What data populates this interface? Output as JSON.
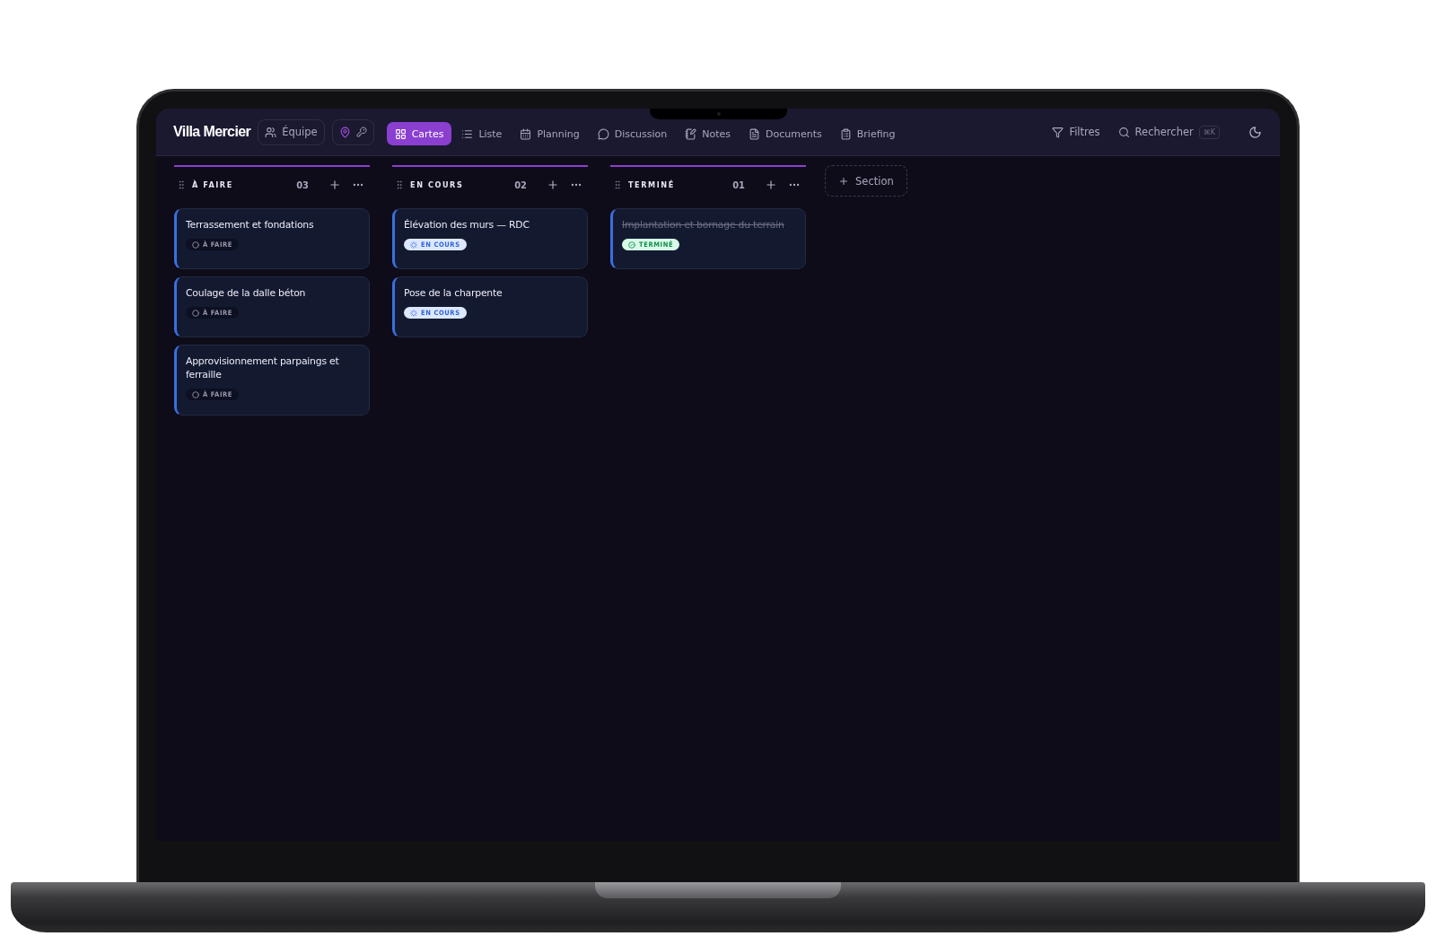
{
  "app": {
    "title": "Villa Mercier",
    "team_button": {
      "label": "Équipe"
    },
    "nav": [
      {
        "label": "Cartes",
        "selected": true
      },
      {
        "label": "Liste",
        "selected": false
      },
      {
        "label": "Planning",
        "selected": false
      },
      {
        "label": "Discussion",
        "selected": false
      },
      {
        "label": "Notes",
        "selected": false
      },
      {
        "label": "Documents",
        "selected": false
      },
      {
        "label": "Briefing",
        "selected": false
      }
    ],
    "filters": {
      "label": "Filtres"
    },
    "search": {
      "placeholder": "Rechercher",
      "shortcut": "⌘K"
    }
  },
  "columns": [
    {
      "title": "À FAIRE",
      "count": "03",
      "cards": [
        {
          "title": "Terrassement et fondations",
          "done": false,
          "status": {
            "kind": "todo",
            "label": "À FAIRE"
          }
        },
        {
          "title": "Coulage de la dalle béton",
          "done": false,
          "status": {
            "kind": "todo",
            "label": "À FAIRE"
          }
        },
        {
          "title": "Approvisionnement parpaings et ferraille",
          "done": false,
          "status": {
            "kind": "todo",
            "label": "À FAIRE"
          }
        }
      ]
    },
    {
      "title": "EN COURS",
      "count": "02",
      "cards": [
        {
          "title": "Élévation des murs — RDC",
          "done": false,
          "status": {
            "kind": "progress",
            "label": "EN COURS"
          }
        },
        {
          "title": "Pose de la charpente",
          "done": false,
          "status": {
            "kind": "progress",
            "label": "EN COURS"
          }
        }
      ]
    },
    {
      "title": "TERMINÉ",
      "count": "01",
      "cards": [
        {
          "title": "Implantation et bornage du terrain",
          "done": true,
          "status": {
            "kind": "done",
            "label": "TERMINÉ"
          }
        }
      ]
    }
  ],
  "add_section": {
    "label": "Section"
  }
}
